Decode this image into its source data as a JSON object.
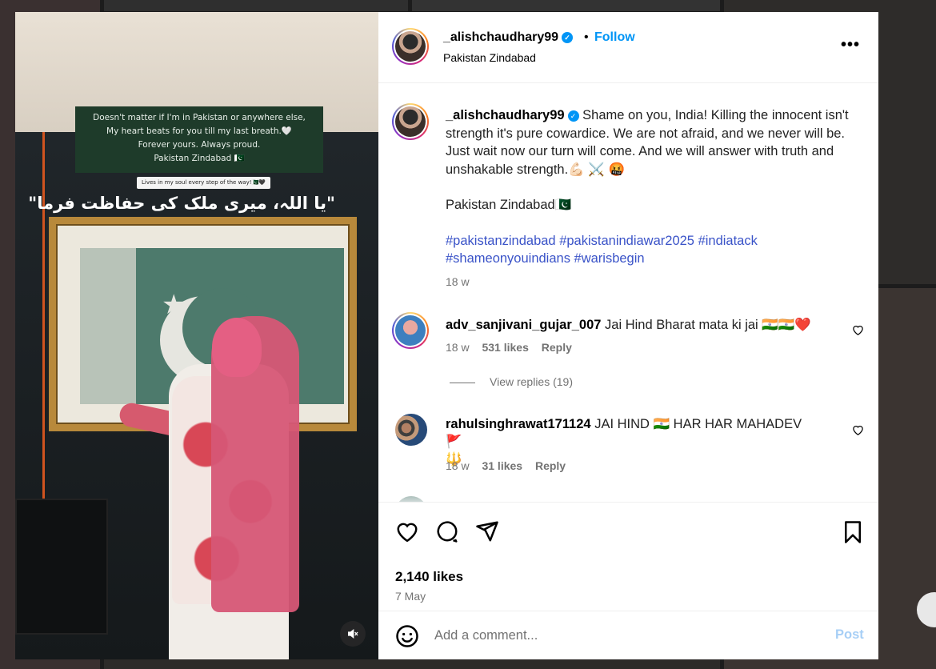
{
  "post": {
    "username": "_alishchaudhary99",
    "follow_label": "Follow",
    "dot": "•",
    "location": "Pakistan Zindabad",
    "more_label": "•••"
  },
  "media": {
    "overlay_lines": [
      "Doesn't matter if I'm in Pakistan or anywhere else,",
      "My heart beats for you till my last breath.🤍",
      "Forever yours. Always proud.",
      "Pakistan Zindabad 🇵🇰"
    ],
    "pill_text": "Lives in my soul every step of the way!🇵🇰🖤",
    "urdu_text": "\"یا اللہ، میری ملک کی حفاظت فرما\""
  },
  "caption": {
    "username": "_alishchaudhary99",
    "text": "Shame on you, India! Killing the innocent isn't strength it's pure cowardice. We are not afraid, and we never will be. Just wait now our turn will come. And we will answer with truth and unshakable strength.💪🏻 ⚔️ 🤬",
    "line2": "Pakistan Zindabad🇵🇰",
    "hashtags": "#pakistanzindabad #pakistanindiawar2025 #indiatack #shameonyouindians #warisbegin",
    "time": "18 w"
  },
  "comments": [
    {
      "username": "adv_sanjivani_gujar_007",
      "text": "Jai Hind Bharat mata ki jai 🇮🇳🇮🇳❤️",
      "time": "18 w",
      "likes": "531 likes",
      "reply": "Reply"
    },
    {
      "username": "rahulsinghrawat171124",
      "text": "JAI HIND 🇮🇳 HAR HAR MAHADEV 🚩",
      "text2": "🔱",
      "time": "18 w",
      "likes": "31 likes",
      "reply": "Reply"
    }
  ],
  "view_replies": "View replies (19)",
  "actions": {
    "likes": "2,140 likes",
    "date": "7 May"
  },
  "add_comment": {
    "placeholder": "Add a comment...",
    "post_label": "Post"
  }
}
